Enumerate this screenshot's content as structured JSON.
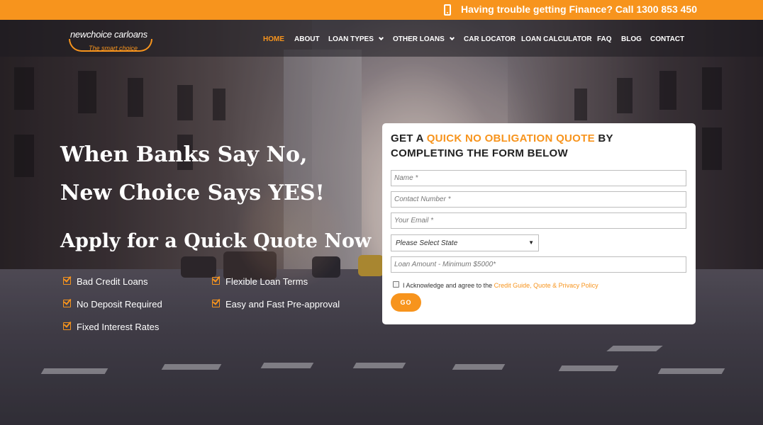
{
  "topbar": {
    "message": "Having trouble getting Finance? Call 1300 853 450",
    "icon": "mobile-phone-icon"
  },
  "logo": {
    "name": "newchoice carloans",
    "tagline": "The smart choice"
  },
  "nav": {
    "items": [
      {
        "label": "HOME",
        "active": true
      },
      {
        "label": "ABOUT"
      },
      {
        "label": "LOAN TYPES",
        "dropdown": true
      },
      {
        "label": "OTHER LOANS",
        "dropdown": true
      },
      {
        "label": "CAR LOCATOR"
      },
      {
        "label": "LOAN CALCULATOR"
      },
      {
        "label": "FAQ"
      },
      {
        "label": "BLOG"
      },
      {
        "label": "CONTACT"
      }
    ]
  },
  "hero": {
    "line1": "When Banks Say No,",
    "line2": "New Choice Says YES!",
    "line3": "Apply for a Quick Quote Now",
    "features": [
      "Bad Credit Loans",
      "Flexible Loan Terms",
      "No Deposit Required",
      "Easy and Fast Pre-approval",
      "Fixed Interest Rates"
    ]
  },
  "form": {
    "title_prefix": "GET A ",
    "title_accent": "QUICK NO OBLIGATION QUOTE",
    "title_suffix": " BY COMPLETING THE FORM BELOW",
    "name_placeholder": "Name *",
    "contact_placeholder": "Contact Number *",
    "email_placeholder": "Your Email *",
    "state_selected": "Please Select State",
    "loan_placeholder": "Loan Amount - Minimum $5000*",
    "ack_text": "I Acknowledge and agree to the ",
    "ack_link": "Credit Guide, Quote & Privacy Policy",
    "submit_label": "GO"
  },
  "colors": {
    "accent": "#f7941d",
    "text_dark": "#222222"
  }
}
